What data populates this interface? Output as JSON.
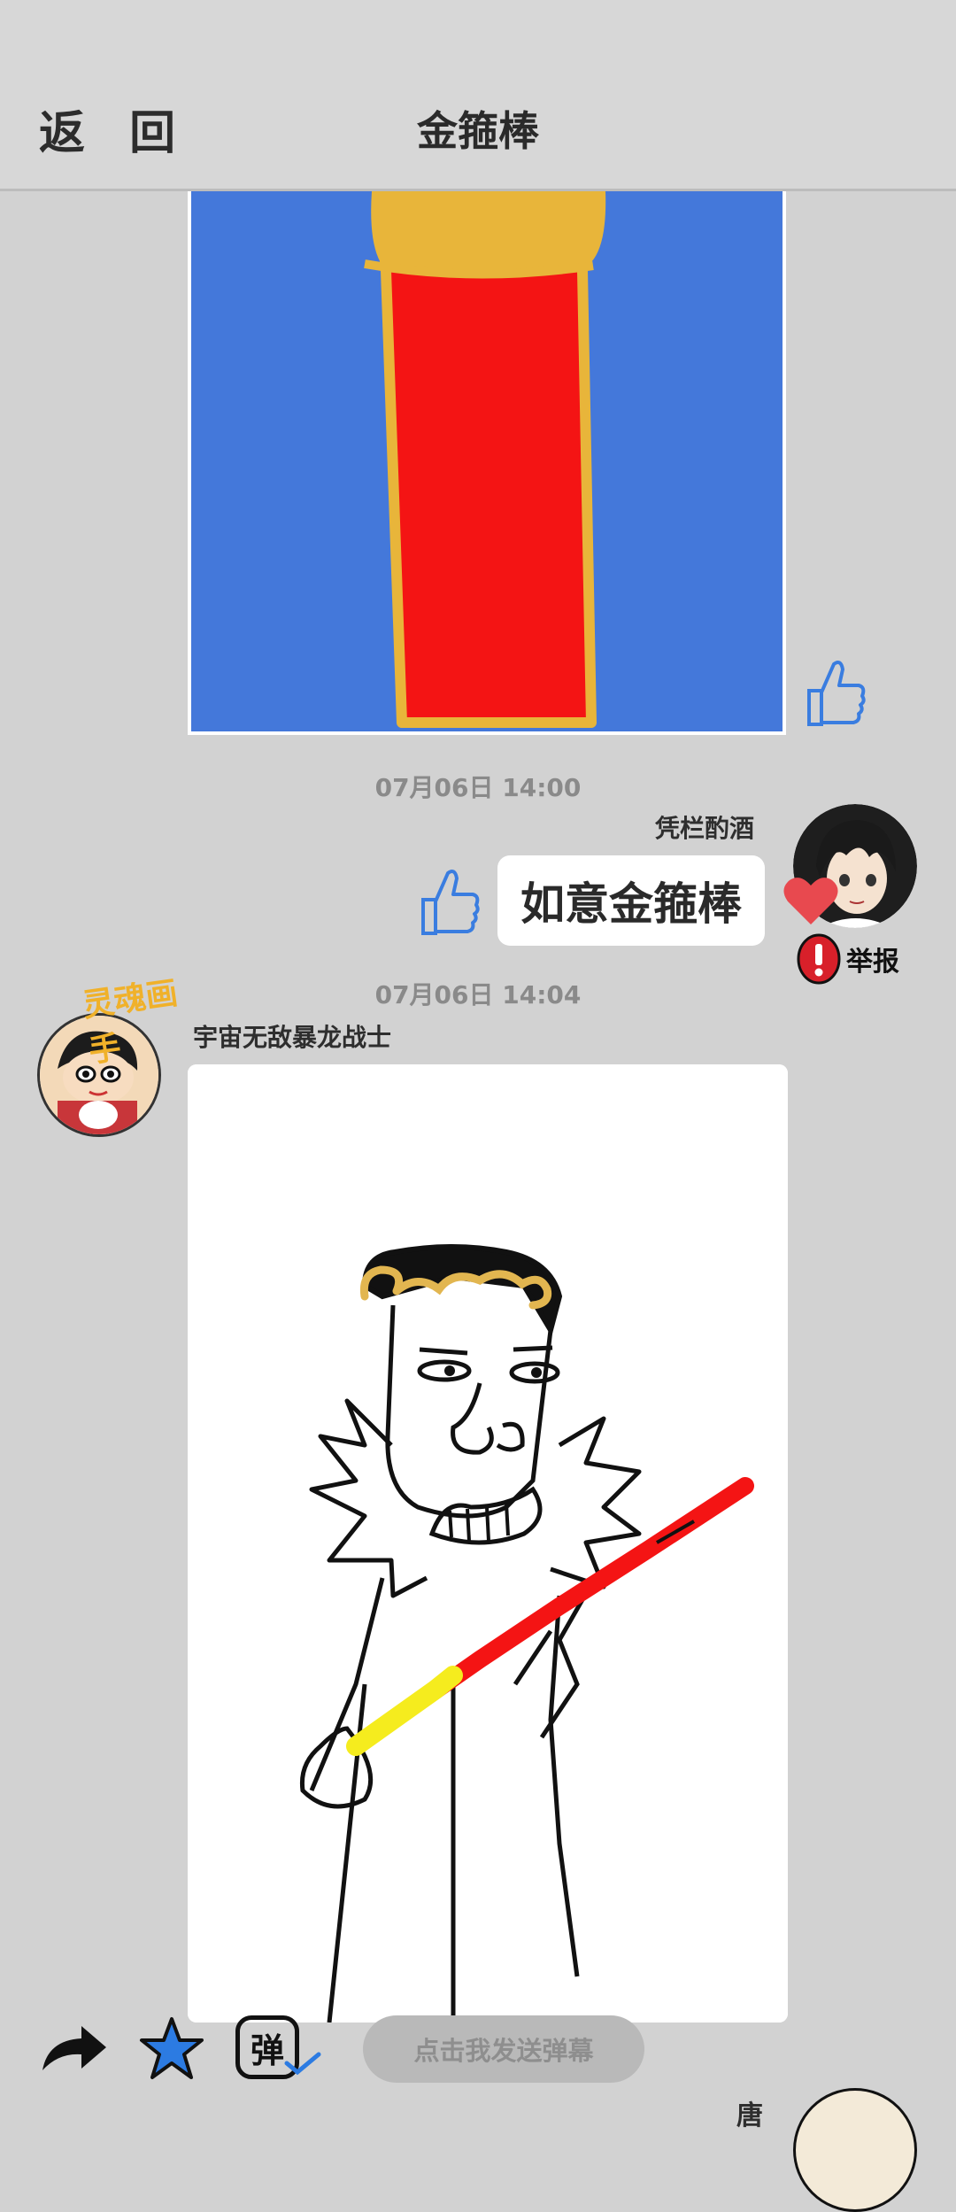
{
  "header": {
    "back_label": "返 回",
    "title": "金箍棒"
  },
  "post1": {
    "image_alt": "金箍棒 drawing"
  },
  "msg1": {
    "timestamp": "07月06日  14:00",
    "username": "凭栏酌酒",
    "text": "如意金箍棒",
    "report_label": "举报"
  },
  "msg2": {
    "timestamp": "07月06日  14:04",
    "username": "宇宙无敌暴龙战士",
    "badge_text": "灵魂画手"
  },
  "bottom": {
    "danmu_placeholder": "点击我发送弹幕",
    "danmu_icon_char": "弹"
  },
  "msg3": {
    "username": "唐"
  },
  "colors": {
    "like_blue": "#3a7de0",
    "heart_red": "#e8494f",
    "report_red": "#d8202a",
    "canvas_blue": "#4478da",
    "staff_red": "#f41414",
    "staff_gold": "#e8b53a"
  }
}
